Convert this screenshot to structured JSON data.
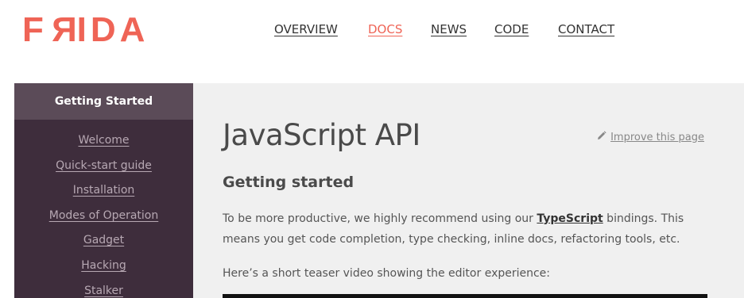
{
  "logo": {
    "text_start": "F",
    "text_reversed": "R",
    "text_end": "IDA"
  },
  "nav": {
    "items": [
      {
        "label": "OVERVIEW",
        "active": false
      },
      {
        "label": "DOCS",
        "active": true
      },
      {
        "label": "NEWS",
        "active": false
      },
      {
        "label": "CODE",
        "active": false
      },
      {
        "label": "CONTACT",
        "active": false
      }
    ]
  },
  "sidebar": {
    "header": "Getting Started",
    "items": [
      {
        "label": "Welcome"
      },
      {
        "label": "Quick-start guide"
      },
      {
        "label": "Installation"
      },
      {
        "label": "Modes of Operation"
      },
      {
        "label": "Gadget"
      },
      {
        "label": "Hacking"
      },
      {
        "label": "Stalker"
      }
    ]
  },
  "main": {
    "title": "JavaScript API",
    "improve_label": "Improve this page",
    "improve_icon": "pencil-icon",
    "section_title": "Getting started",
    "para1_before": "To be more productive, we highly recommend using our ",
    "para1_link": "TypeScript",
    "para1_after": " bindings. This means you get code completion, type checking, inline docs, refactoring tools, etc.",
    "para2": "Here’s a short teaser video showing the editor experience:"
  },
  "colors": {
    "brand": "#ef6456",
    "sidebar_bg": "#3e2d3c",
    "sidebar_header_bg": "#5b4b58",
    "content_bg": "#f0f0f0"
  }
}
